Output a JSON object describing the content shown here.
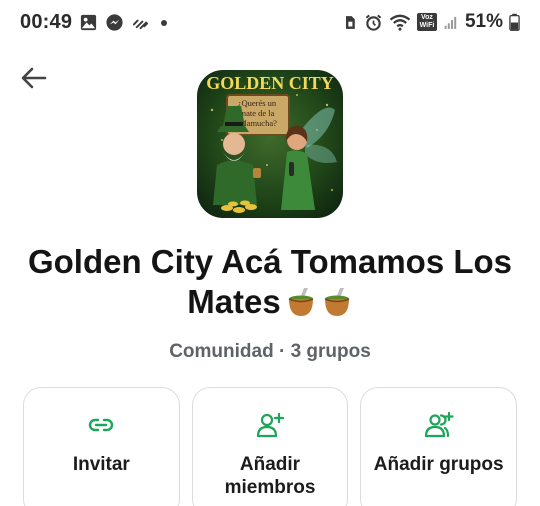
{
  "status_bar": {
    "time": "00:49",
    "battery_percent": "51%",
    "volte_label": "Voz\nWiFi"
  },
  "community": {
    "image_caption": "GOLDEN CITY",
    "image_sign_text": "¿Querés un mate de la Mamucha?",
    "title": "Golden City Acá Tomamos Los Mates",
    "subtitle": "Comunidad · 3 grupos"
  },
  "actions": [
    {
      "label": "Invitar",
      "icon": "link-icon"
    },
    {
      "label": "Añadir miembros",
      "icon": "add-person-icon"
    },
    {
      "label": "Añadir grupos",
      "icon": "add-group-icon"
    }
  ],
  "colors": {
    "accent": "#1da55a",
    "text": "#141414",
    "subtle": "#5f6368",
    "border": "#dcdcdc"
  }
}
